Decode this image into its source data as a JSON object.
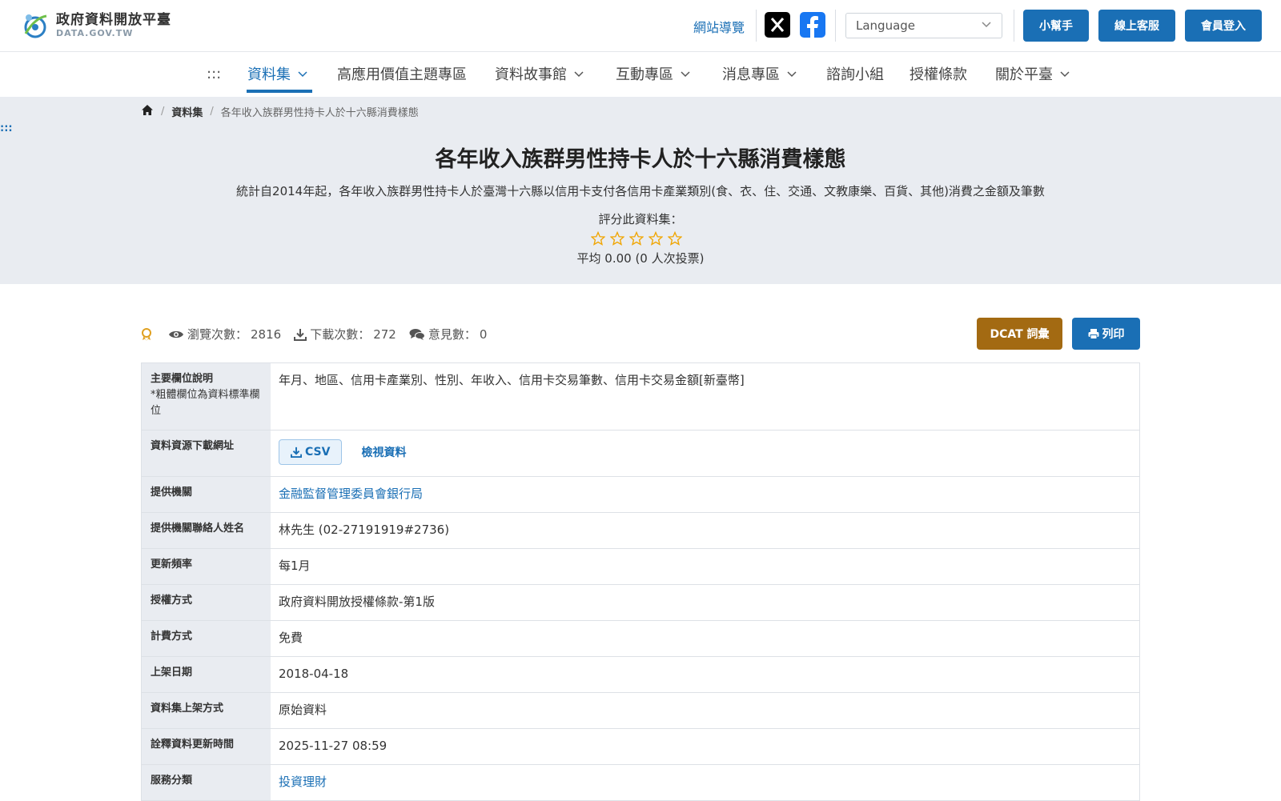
{
  "header": {
    "logo_title": "政府資料開放平臺",
    "logo_sub": "DATA.GOV.TW",
    "sitemap": "網站導覽",
    "language_placeholder": "Language",
    "buttons": {
      "helper": "小幫手",
      "support": "線上客服",
      "login": "會員登入"
    }
  },
  "nav": {
    "accesskey": ":::",
    "items": [
      {
        "label": "資料集"
      },
      {
        "label": "高應用價值主題專區"
      },
      {
        "label": "資料故事館"
      },
      {
        "label": "互動專區"
      },
      {
        "label": "消息專區"
      },
      {
        "label": "諮詢小組"
      },
      {
        "label": "授權條款"
      },
      {
        "label": "關於平臺"
      }
    ]
  },
  "breadcrumb": {
    "level1": "資料集",
    "current": "各年收入族群男性持卡人於十六縣消費樣態"
  },
  "content_accesskey": ":::",
  "dataset": {
    "title": "各年收入族群男性持卡人於十六縣消費樣態",
    "description": "統計自2014年起，各年收入族群男性持卡人於臺灣十六縣以信用卡支付各信用卡產業類別(食、衣、住、交通、文教康樂、百貨、其他)消費之金額及筆數",
    "rate_label": "評分此資料集：",
    "rating_stars": 0,
    "rating_avg": "平均 0.00 (0 人次投票)"
  },
  "stats": {
    "views_label": "瀏覽次數：",
    "views": "2816",
    "downloads_label": "下載次數：",
    "downloads": "272",
    "comments_label": "意見數：",
    "comments": "0"
  },
  "actions": {
    "dcat": "DCAT 詞彙",
    "print": "列印"
  },
  "table": {
    "fields_label": "主要欄位說明",
    "fields_note": "*粗體欄位為資料標準欄位",
    "fields_value": "年月、地區、信用卡產業別、性別、年收入、信用卡交易筆數、信用卡交易金額[新臺幣]",
    "download_label": "資料資源下載網址",
    "csv_label": "CSV",
    "view_label": "檢視資料",
    "provider_label": "提供機關",
    "provider_value": "金融監督管理委員會銀行局",
    "contact_label": "提供機關聯絡人姓名",
    "contact_value": "林先生 (02-27191919#2736)",
    "frequency_label": "更新頻率",
    "frequency_value": "每1月",
    "license_label": "授權方式",
    "license_value": "政府資料開放授權條款-第1版",
    "fee_label": "計費方式",
    "fee_value": "免費",
    "published_label": "上架日期",
    "published_value": "2018-04-18",
    "method_label": "資料集上架方式",
    "method_value": "原始資料",
    "meta_updated_label": "詮釋資料更新時間",
    "meta_updated_value": "2025-11-27 08:59",
    "category_label": "服務分類",
    "category_value": "投資理財"
  },
  "colors": {
    "primary": "#1a6fb5",
    "dcat": "#a36a12",
    "star": "#f0a500",
    "hero_bg": "#e9ecf1"
  }
}
